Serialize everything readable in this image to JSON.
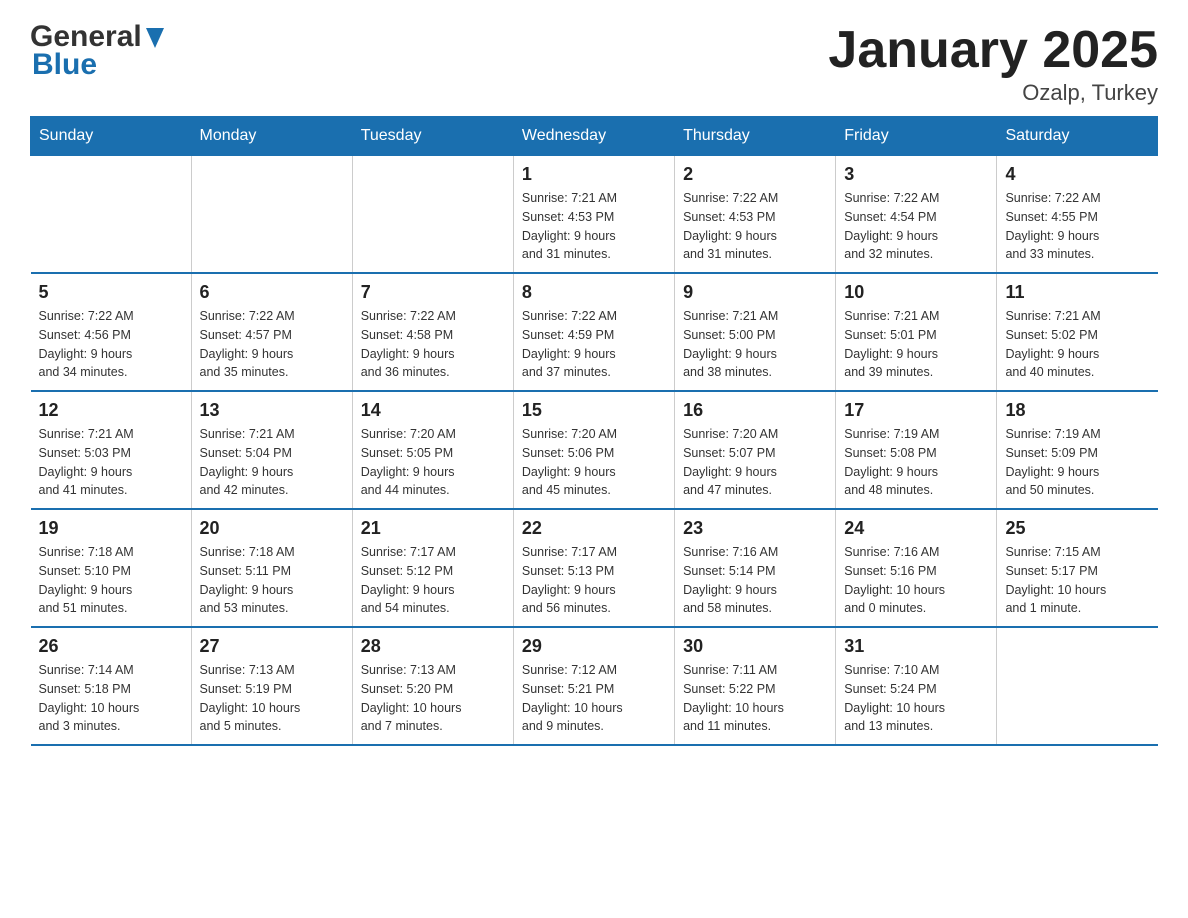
{
  "logo": {
    "text_general": "General",
    "text_blue": "Blue"
  },
  "title": "January 2025",
  "subtitle": "Ozalp, Turkey",
  "weekdays": [
    "Sunday",
    "Monday",
    "Tuesday",
    "Wednesday",
    "Thursday",
    "Friday",
    "Saturday"
  ],
  "weeks": [
    [
      {
        "day": "",
        "info": ""
      },
      {
        "day": "",
        "info": ""
      },
      {
        "day": "",
        "info": ""
      },
      {
        "day": "1",
        "info": "Sunrise: 7:21 AM\nSunset: 4:53 PM\nDaylight: 9 hours\nand 31 minutes."
      },
      {
        "day": "2",
        "info": "Sunrise: 7:22 AM\nSunset: 4:53 PM\nDaylight: 9 hours\nand 31 minutes."
      },
      {
        "day": "3",
        "info": "Sunrise: 7:22 AM\nSunset: 4:54 PM\nDaylight: 9 hours\nand 32 minutes."
      },
      {
        "day": "4",
        "info": "Sunrise: 7:22 AM\nSunset: 4:55 PM\nDaylight: 9 hours\nand 33 minutes."
      }
    ],
    [
      {
        "day": "5",
        "info": "Sunrise: 7:22 AM\nSunset: 4:56 PM\nDaylight: 9 hours\nand 34 minutes."
      },
      {
        "day": "6",
        "info": "Sunrise: 7:22 AM\nSunset: 4:57 PM\nDaylight: 9 hours\nand 35 minutes."
      },
      {
        "day": "7",
        "info": "Sunrise: 7:22 AM\nSunset: 4:58 PM\nDaylight: 9 hours\nand 36 minutes."
      },
      {
        "day": "8",
        "info": "Sunrise: 7:22 AM\nSunset: 4:59 PM\nDaylight: 9 hours\nand 37 minutes."
      },
      {
        "day": "9",
        "info": "Sunrise: 7:21 AM\nSunset: 5:00 PM\nDaylight: 9 hours\nand 38 minutes."
      },
      {
        "day": "10",
        "info": "Sunrise: 7:21 AM\nSunset: 5:01 PM\nDaylight: 9 hours\nand 39 minutes."
      },
      {
        "day": "11",
        "info": "Sunrise: 7:21 AM\nSunset: 5:02 PM\nDaylight: 9 hours\nand 40 minutes."
      }
    ],
    [
      {
        "day": "12",
        "info": "Sunrise: 7:21 AM\nSunset: 5:03 PM\nDaylight: 9 hours\nand 41 minutes."
      },
      {
        "day": "13",
        "info": "Sunrise: 7:21 AM\nSunset: 5:04 PM\nDaylight: 9 hours\nand 42 minutes."
      },
      {
        "day": "14",
        "info": "Sunrise: 7:20 AM\nSunset: 5:05 PM\nDaylight: 9 hours\nand 44 minutes."
      },
      {
        "day": "15",
        "info": "Sunrise: 7:20 AM\nSunset: 5:06 PM\nDaylight: 9 hours\nand 45 minutes."
      },
      {
        "day": "16",
        "info": "Sunrise: 7:20 AM\nSunset: 5:07 PM\nDaylight: 9 hours\nand 47 minutes."
      },
      {
        "day": "17",
        "info": "Sunrise: 7:19 AM\nSunset: 5:08 PM\nDaylight: 9 hours\nand 48 minutes."
      },
      {
        "day": "18",
        "info": "Sunrise: 7:19 AM\nSunset: 5:09 PM\nDaylight: 9 hours\nand 50 minutes."
      }
    ],
    [
      {
        "day": "19",
        "info": "Sunrise: 7:18 AM\nSunset: 5:10 PM\nDaylight: 9 hours\nand 51 minutes."
      },
      {
        "day": "20",
        "info": "Sunrise: 7:18 AM\nSunset: 5:11 PM\nDaylight: 9 hours\nand 53 minutes."
      },
      {
        "day": "21",
        "info": "Sunrise: 7:17 AM\nSunset: 5:12 PM\nDaylight: 9 hours\nand 54 minutes."
      },
      {
        "day": "22",
        "info": "Sunrise: 7:17 AM\nSunset: 5:13 PM\nDaylight: 9 hours\nand 56 minutes."
      },
      {
        "day": "23",
        "info": "Sunrise: 7:16 AM\nSunset: 5:14 PM\nDaylight: 9 hours\nand 58 minutes."
      },
      {
        "day": "24",
        "info": "Sunrise: 7:16 AM\nSunset: 5:16 PM\nDaylight: 10 hours\nand 0 minutes."
      },
      {
        "day": "25",
        "info": "Sunrise: 7:15 AM\nSunset: 5:17 PM\nDaylight: 10 hours\nand 1 minute."
      }
    ],
    [
      {
        "day": "26",
        "info": "Sunrise: 7:14 AM\nSunset: 5:18 PM\nDaylight: 10 hours\nand 3 minutes."
      },
      {
        "day": "27",
        "info": "Sunrise: 7:13 AM\nSunset: 5:19 PM\nDaylight: 10 hours\nand 5 minutes."
      },
      {
        "day": "28",
        "info": "Sunrise: 7:13 AM\nSunset: 5:20 PM\nDaylight: 10 hours\nand 7 minutes."
      },
      {
        "day": "29",
        "info": "Sunrise: 7:12 AM\nSunset: 5:21 PM\nDaylight: 10 hours\nand 9 minutes."
      },
      {
        "day": "30",
        "info": "Sunrise: 7:11 AM\nSunset: 5:22 PM\nDaylight: 10 hours\nand 11 minutes."
      },
      {
        "day": "31",
        "info": "Sunrise: 7:10 AM\nSunset: 5:24 PM\nDaylight: 10 hours\nand 13 minutes."
      },
      {
        "day": "",
        "info": ""
      }
    ]
  ]
}
